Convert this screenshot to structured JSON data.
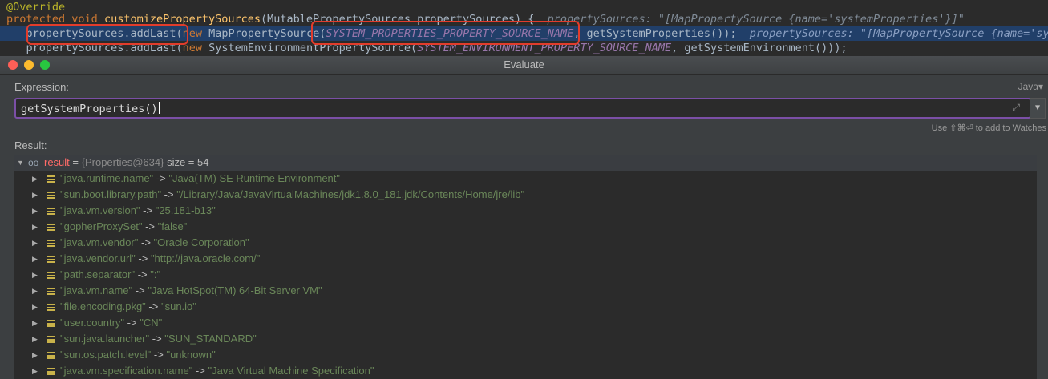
{
  "editor": {
    "annotation": "@Override",
    "line2": {
      "kw1": "protected",
      "kw2": "void",
      "method": "customizePropertySources",
      "params": "(MutablePropertySources propertySources) {",
      "hint": "propertySources: \"[MapPropertySource {name='systemProperties'}]\""
    },
    "line3": {
      "call": "    propertySources.addLast(",
      "kwnew": "new",
      "cls": " MapPropertySource(",
      "const": "SYSTEM_PROPERTIES_PROPERTY_SOURCE_NAME",
      "rest": ", getSystemProperties());",
      "hint": "  propertySources: \"[MapPropertySource {name='sys"
    },
    "line4": {
      "call": "    propertySources.addLast(",
      "kwnew": "new",
      "cls": " SystemEnvironmentPropertySource(",
      "const": "SYSTEM_ENVIRONMENT_PROPERTY_SOURCE_NAME",
      "rest": ", getSystemEnvironment()));"
    }
  },
  "dialog": {
    "title": "Evaluate",
    "expression_label": "Expression:",
    "language": "Java",
    "language_arrow": "▾",
    "expression_value": "getSystemProperties()",
    "expand_icon": "⤢",
    "dropdown_icon": "▼",
    "watch_hint": "Use ⇧⌘⏎ to add to Watches",
    "result_label": "Result:"
  },
  "result": {
    "watch_glyph": "oo",
    "name": "result",
    "eq": " = ",
    "type": "{Properties@634}",
    "size": "  size = 54",
    "expanded_arrow": "▼",
    "collapsed_arrow": "▶",
    "items": [
      {
        "key": "\"java.runtime.name\"",
        "value": "\"Java(TM) SE Runtime Environment\""
      },
      {
        "key": "\"sun.boot.library.path\"",
        "value": "\"/Library/Java/JavaVirtualMachines/jdk1.8.0_181.jdk/Contents/Home/jre/lib\""
      },
      {
        "key": "\"java.vm.version\"",
        "value": "\"25.181-b13\""
      },
      {
        "key": "\"gopherProxySet\"",
        "value": "\"false\""
      },
      {
        "key": "\"java.vm.vendor\"",
        "value": "\"Oracle Corporation\""
      },
      {
        "key": "\"java.vendor.url\"",
        "value": "\"http://java.oracle.com/\""
      },
      {
        "key": "\"path.separator\"",
        "value": "\":\""
      },
      {
        "key": "\"java.vm.name\"",
        "value": "\"Java HotSpot(TM) 64-Bit Server VM\""
      },
      {
        "key": "\"file.encoding.pkg\"",
        "value": "\"sun.io\""
      },
      {
        "key": "\"user.country\"",
        "value": "\"CN\""
      },
      {
        "key": "\"sun.java.launcher\"",
        "value": "\"SUN_STANDARD\""
      },
      {
        "key": "\"sun.os.patch.level\"",
        "value": "\"unknown\""
      },
      {
        "key": "\"java.vm.specification.name\"",
        "value": "\"Java Virtual Machine Specification\""
      }
    ],
    "arrow_sep": " -> "
  },
  "colors": {
    "highlight_box": "#e23c2b",
    "focus_border": "#7b4fa6",
    "string_value": "#6a8759",
    "result_name": "#ff6b68"
  }
}
